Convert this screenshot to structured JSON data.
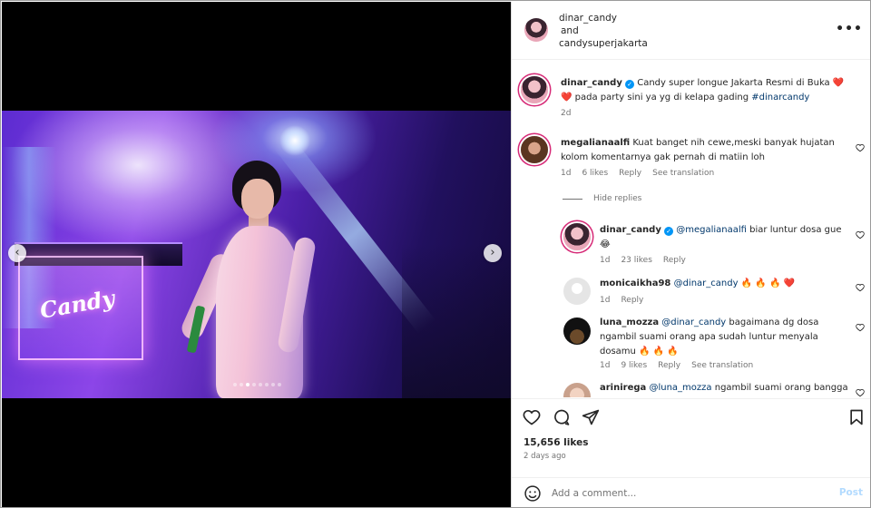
{
  "post": {
    "author": "dinar_candy",
    "and_text": "and",
    "collaborator": "candysuperjakarta",
    "more_icon": "more-options-icon"
  },
  "media": {
    "logo_text": "Candy",
    "carousel_total": 8,
    "carousel_current": 3
  },
  "caption": {
    "username": "dinar_candy",
    "text_part1": "Candy super longue Jakarta Resmi di Buka ",
    "emoji_hearts": "❤️ ❤️",
    "text_part2": " pada party sini ya yg di kelapa gading ",
    "hashtag": "#dinarcandy",
    "time": "2d"
  },
  "comments": [
    {
      "username": "megalianaalfi",
      "text": "Kuat banget nih cewe,meski banyak hujatan kolom komentarnya gak pernah di matiin loh",
      "time": "1d",
      "likes": "6 likes",
      "reply": "Reply",
      "translate": "See translation"
    }
  ],
  "hide_replies": "Hide replies",
  "replies": [
    {
      "username": "dinar_candy",
      "mention": "@megalianaalfi",
      "text": " biar luntur dosa gue",
      "emoji": "😂",
      "time": "1d",
      "likes": "23 likes",
      "reply": "Reply"
    },
    {
      "username": "monicaikha98",
      "mention": "@dinar_candy",
      "emoji": "🔥 🔥 🔥 ❤️",
      "time": "1d",
      "reply": "Reply"
    },
    {
      "username": "luna_mozza",
      "mention": "@dinar_candy",
      "text": " bagaimana dg dosa ngambil suami orang apa sudah luntur menyala dosamu ",
      "emoji": "🔥 🔥 🔥",
      "time": "1d",
      "likes": "9 likes",
      "reply": "Reply",
      "translate": "See translation"
    },
    {
      "username": "arinirega",
      "mention": "@luna_mozza",
      "text": " ngambil suami orang bangga"
    }
  ],
  "actions": {
    "like_icon": "heart-icon",
    "comment_icon": "comment-icon",
    "share_icon": "share-icon",
    "save_icon": "bookmark-icon",
    "likes_count": "15,656 likes",
    "time_ago": "2 days ago"
  },
  "add_comment": {
    "placeholder": "Add a comment...",
    "post_label": "Post"
  },
  "colors": {
    "link": "#00376b",
    "muted": "#737373",
    "verified": "#0095f6",
    "post_disabled": "#b3dbff",
    "story_ring": "#d62976"
  }
}
